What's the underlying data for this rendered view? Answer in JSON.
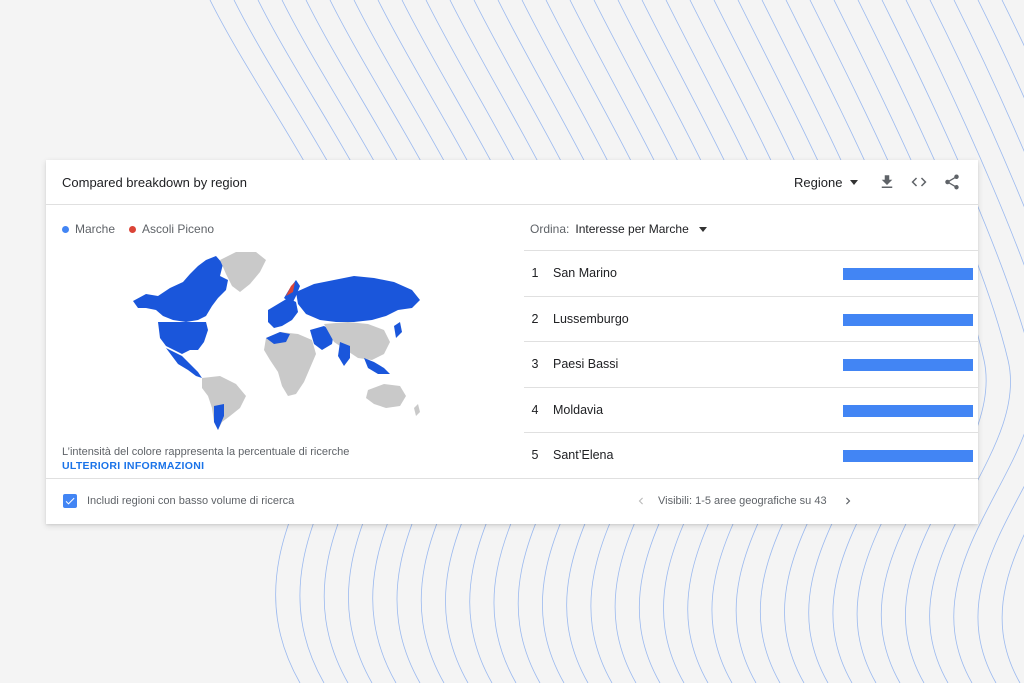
{
  "card": {
    "title": "Compared breakdown by region",
    "region_select": "Regione",
    "icons": [
      "download-icon",
      "embed-code-icon",
      "share-icon"
    ]
  },
  "legend": {
    "items": [
      {
        "label": "Marche",
        "color": "#4285f4"
      },
      {
        "label": "Ascoli Piceno",
        "color": "#db4437"
      }
    ]
  },
  "map": {
    "note": "L’intensità del colore rappresenta la percentuale di ricerche",
    "more_link": "ULTERIORI INFORMAZIONI",
    "colors": {
      "highlight": "#1a56db",
      "other": "#c9c9c9",
      "accent": "#db4437"
    }
  },
  "sort": {
    "label": "Ordina:",
    "value": "Interesse per Marche"
  },
  "ranking": [
    {
      "rank": "1",
      "name": "San Marino",
      "value": 100
    },
    {
      "rank": "2",
      "name": "Lussemburgo",
      "value": 100
    },
    {
      "rank": "3",
      "name": "Paesi Bassi",
      "value": 100
    },
    {
      "rank": "4",
      "name": "Moldavia",
      "value": 100
    },
    {
      "rank": "5",
      "name": "Sant’Elena",
      "value": 100
    }
  ],
  "footer": {
    "checkbox_label": "Includi regioni con basso volume di ricerca",
    "checkbox_checked": true,
    "pager_text": "Visibili: 1-5 aree geografiche su 43"
  },
  "colors": {
    "accent": "#4285f4",
    "link": "#1a73e8",
    "background": "#f4f4f4"
  }
}
